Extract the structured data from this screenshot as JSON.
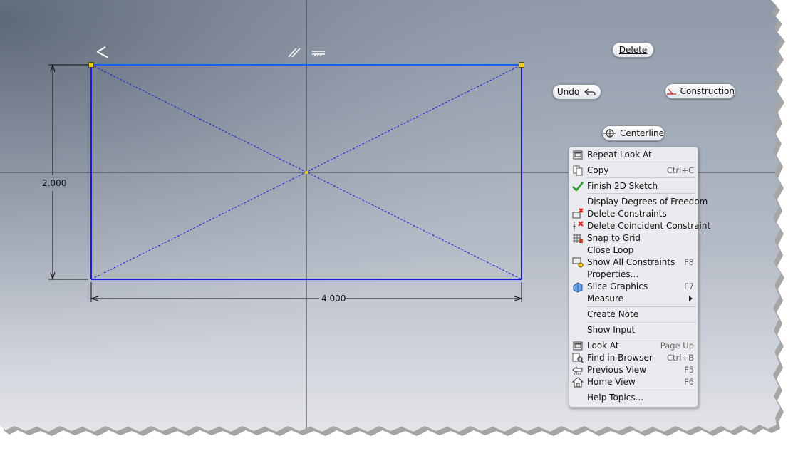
{
  "canvas": {
    "dimension_height": "2.000",
    "dimension_width": "4.000"
  },
  "mini_toolbar": {
    "delete_label": "Delete",
    "undo_label": "Undo",
    "construction_label": "Construction",
    "centerline_label": "Centerline"
  },
  "context_menu": {
    "items": [
      {
        "label": "Repeat Look At",
        "shortcut": "",
        "icon": "look-at-icon"
      },
      {
        "label": "Copy",
        "shortcut": "Ctrl+C",
        "icon": "copy-icon"
      },
      {
        "label": "Finish 2D Sketch",
        "shortcut": "",
        "icon": "checkmark-icon"
      },
      {
        "label": "Display Degrees of Freedom",
        "shortcut": "",
        "icon": ""
      },
      {
        "label": "Delete Constraints",
        "shortcut": "",
        "icon": "delete-constraints-icon"
      },
      {
        "label": "Delete Coincident Constraint",
        "shortcut": "",
        "icon": "delete-coincident-icon"
      },
      {
        "label": "Snap to Grid",
        "shortcut": "",
        "icon": "snap-grid-icon"
      },
      {
        "label": "Close Loop",
        "shortcut": "",
        "icon": ""
      },
      {
        "label": "Show All Constraints",
        "shortcut": "F8",
        "icon": "show-constraints-icon"
      },
      {
        "label": "Properties...",
        "shortcut": "",
        "icon": ""
      },
      {
        "label": "Slice Graphics",
        "shortcut": "F7",
        "icon": "slice-graphics-icon"
      },
      {
        "label": "Measure",
        "shortcut": "",
        "icon": ""
      },
      {
        "label": "Create Note",
        "shortcut": "",
        "icon": ""
      },
      {
        "label": "Show Input",
        "shortcut": "",
        "icon": ""
      },
      {
        "label": "Look At",
        "shortcut": "Page Up",
        "icon": "look-at-icon"
      },
      {
        "label": "Find in Browser",
        "shortcut": "Ctrl+B",
        "icon": "find-browser-icon"
      },
      {
        "label": "Previous View",
        "shortcut": "F5",
        "icon": "previous-view-icon"
      },
      {
        "label": "Home View",
        "shortcut": "F6",
        "icon": "home-view-icon"
      },
      {
        "label": "Help Topics...",
        "shortcut": "",
        "icon": ""
      }
    ]
  },
  "colors": {
    "sketch_line": "#1a1ad6",
    "selected_line": "#1560f0",
    "background_top": "#8e98a8",
    "background_bottom": "#e8e9ec"
  }
}
